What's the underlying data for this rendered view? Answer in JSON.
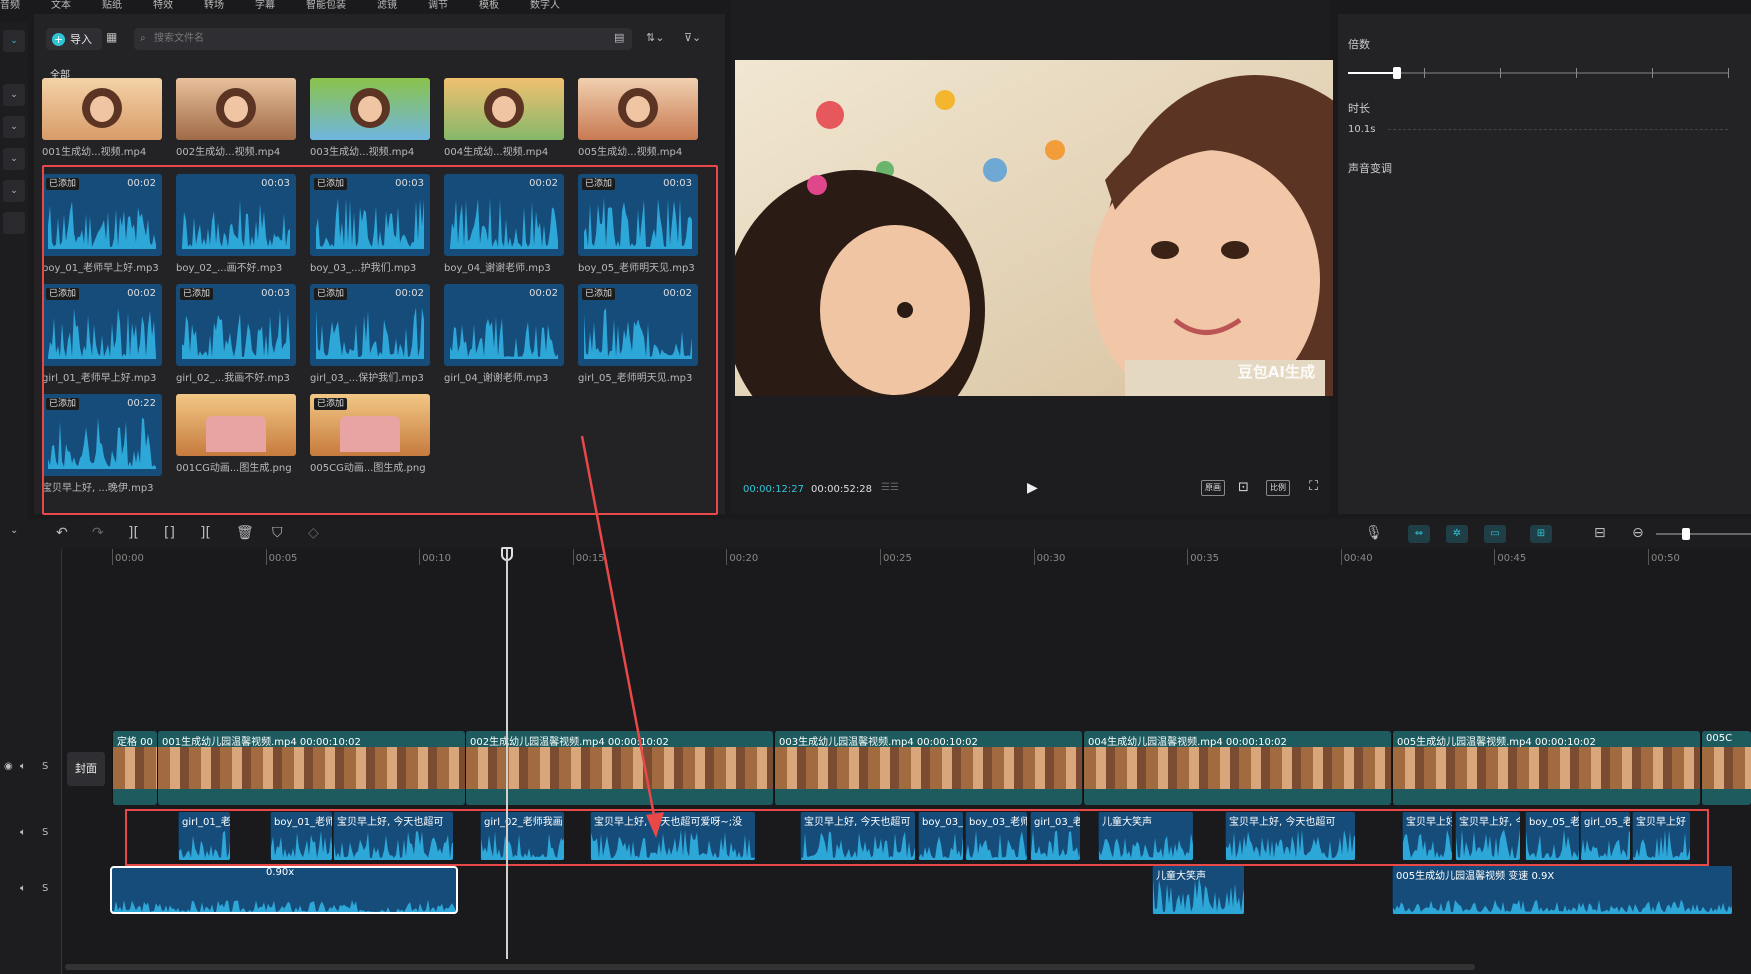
{
  "menu": [
    "音频",
    "文本",
    "贴纸",
    "特效",
    "转场",
    "字幕",
    "智能包装",
    "滤镜",
    "调节",
    "模板",
    "数字人"
  ],
  "media": {
    "import_label": "导入",
    "search_placeholder": "搜索文件名",
    "all_label": "全部",
    "video_items": [
      {
        "label": "001生成幼...视频.mp4"
      },
      {
        "label": "002生成幼...视频.mp4"
      },
      {
        "label": "003生成幼...视频.mp4"
      },
      {
        "label": "004生成幼...视频.mp4"
      },
      {
        "label": "005生成幼...视频.mp4"
      }
    ],
    "audio_items": [
      {
        "label": "boy_01_老师早上好.mp3",
        "badge": "已添加",
        "duration": "00:02"
      },
      {
        "label": "boy_02_...画不好.mp3",
        "badge": "",
        "duration": "00:03"
      },
      {
        "label": "boy_03_...护我们.mp3",
        "badge": "已添加",
        "duration": "00:03"
      },
      {
        "label": "boy_04_谢谢老师.mp3",
        "badge": "",
        "duration": "00:02"
      },
      {
        "label": "boy_05_老师明天见.mp3",
        "badge": "已添加",
        "duration": "00:03"
      },
      {
        "label": "girl_01_老师早上好.mp3",
        "badge": "已添加",
        "duration": "00:02"
      },
      {
        "label": "girl_02_...我画不好.mp3",
        "badge": "已添加",
        "duration": "00:03"
      },
      {
        "label": "girl_03_...保护我们.mp3",
        "badge": "已添加",
        "duration": "00:02"
      },
      {
        "label": "girl_04_谢谢老师.mp3",
        "badge": "",
        "duration": "00:02"
      },
      {
        "label": "girl_05_老师明天见.mp3",
        "badge": "已添加",
        "duration": "00:02"
      },
      {
        "label": "宝贝早上好, ...晚伊.mp3",
        "badge": "已添加",
        "duration": "00:22"
      }
    ],
    "image_items": [
      {
        "label": "001CG动画...图生成.png",
        "badge": ""
      },
      {
        "label": "005CG动画...图生成.png",
        "badge": "已添加"
      }
    ]
  },
  "preview": {
    "current_time": "00:00:12:27",
    "total_time": "00:00:52:28",
    "watermark": "豆包AI生成",
    "btn_original": "原画",
    "btn_ratio": "比例"
  },
  "props": {
    "speed_label": "倍数",
    "speed_value": 0.13,
    "duration_label": "时长",
    "duration_value": "10.1s",
    "voice_label": "声音变调"
  },
  "timeline": {
    "ruler": [
      "00:00",
      "00:05",
      "00:10",
      "00:15",
      "00:20",
      "00:25",
      "00:30",
      "00:35",
      "00:40",
      "00:45",
      "00:50"
    ],
    "cover_label": "封面",
    "video_clips": [
      {
        "name": "定格 00"
      },
      {
        "name": "001生成幼儿园温馨视频.mp4  00:00:10:02"
      },
      {
        "name": "002生成幼儿园温馨视频.mp4  00:00:10:02"
      },
      {
        "name": "003生成幼儿园温馨视频.mp4  00:00:10:02"
      },
      {
        "name": "004生成幼儿园温馨视频.mp4  00:00:10:02"
      },
      {
        "name": "005生成幼儿园温馨视频.mp4  00:00:10:02"
      },
      {
        "name": "005C"
      }
    ],
    "audio1_clips": [
      {
        "name": "girl_01_老"
      },
      {
        "name": "boy_01_老师"
      },
      {
        "name": "宝贝早上好, 今天也超可"
      },
      {
        "name": "girl_02_老师我画"
      },
      {
        "name": "宝贝早上好, 今天也超可爱呀~;没"
      },
      {
        "name": "宝贝早上好, 今天也超可"
      },
      {
        "name": "boy_03_老"
      },
      {
        "name": "boy_03_老师"
      },
      {
        "name": "girl_03_老"
      },
      {
        "name": "儿童大笑声"
      },
      {
        "name": "宝贝早上好, 今天也超可"
      },
      {
        "name": "宝贝早上好"
      },
      {
        "name": "宝贝早上好, 今"
      },
      {
        "name": "boy_05_老"
      },
      {
        "name": "girl_05_老"
      },
      {
        "name": "宝贝早上好"
      }
    ],
    "audio2_clips": [
      {
        "name": "0.90x"
      },
      {
        "name": "儿童大笑声"
      },
      {
        "name": "005生成幼儿园温馨视频    变速 0.9X"
      }
    ],
    "track_headers": {
      "mute": "S"
    }
  },
  "colors": {
    "accent": "#2fc5d6",
    "highlight": "#e84848",
    "audio": "#164c7a",
    "video": "#1e5b5f"
  }
}
